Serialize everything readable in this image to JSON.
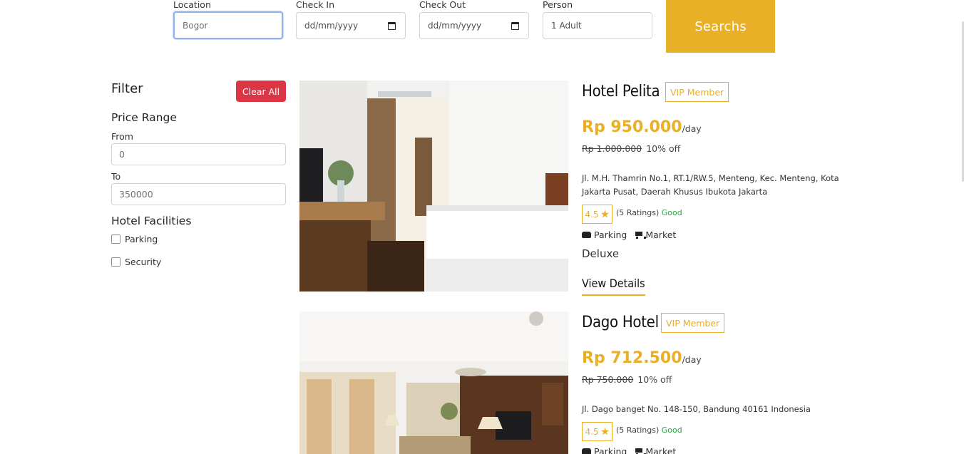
{
  "search": {
    "location": {
      "label": "Location",
      "value": "Bogor"
    },
    "check_in": {
      "label": "Check In",
      "placeholder": "dd/mm/yyyy"
    },
    "check_out": {
      "label": "Check Out",
      "placeholder": "dd/mm/yyyy"
    },
    "person": {
      "label": "Person",
      "value": "1 Adult"
    },
    "button": "Searchs"
  },
  "filter": {
    "title": "Filter",
    "clear_label": "Clear All",
    "price_range": {
      "title": "Price Range",
      "from_label": "From",
      "from_value": "0",
      "to_label": "To",
      "to_value": "350000"
    },
    "facilities": {
      "title": "Hotel Facilities",
      "options": [
        "Parking",
        "Security"
      ]
    }
  },
  "hotels": [
    {
      "name": "Hotel Pelita",
      "badge": "VIP Member",
      "price": "Rp 950.000",
      "unit": "/day",
      "old_price": "Rp 1.000.000",
      "discount": "10% off",
      "address": "Jl. M.H. Thamrin No.1, RT.1/RW.5, Menteng, Kec. Menteng, Kota Jakarta Pusat, Daerah Khusus Ibukota Jakarta",
      "rating": "4.5",
      "ratings_count": "(5 Ratings)",
      "rating_word": "Good",
      "facilities": [
        "Parking",
        "Market"
      ],
      "room_type": "Deluxe",
      "details_label": "View Details"
    },
    {
      "name": "Dago Hotel",
      "badge": "VIP Member",
      "price": "Rp 712.500",
      "unit": "/day",
      "old_price": "Rp 750.000",
      "discount": "10% off",
      "address": "Jl. Dago banget No. 148-150, Bandung 40161 Indonesia",
      "rating": "4.5",
      "ratings_count": "(5 Ratings)",
      "rating_word": "Good",
      "facilities": [
        "Parking",
        "Market"
      ]
    }
  ],
  "colors": {
    "accent": "#e9af26",
    "danger": "#dc3545",
    "good": "#28a745"
  }
}
